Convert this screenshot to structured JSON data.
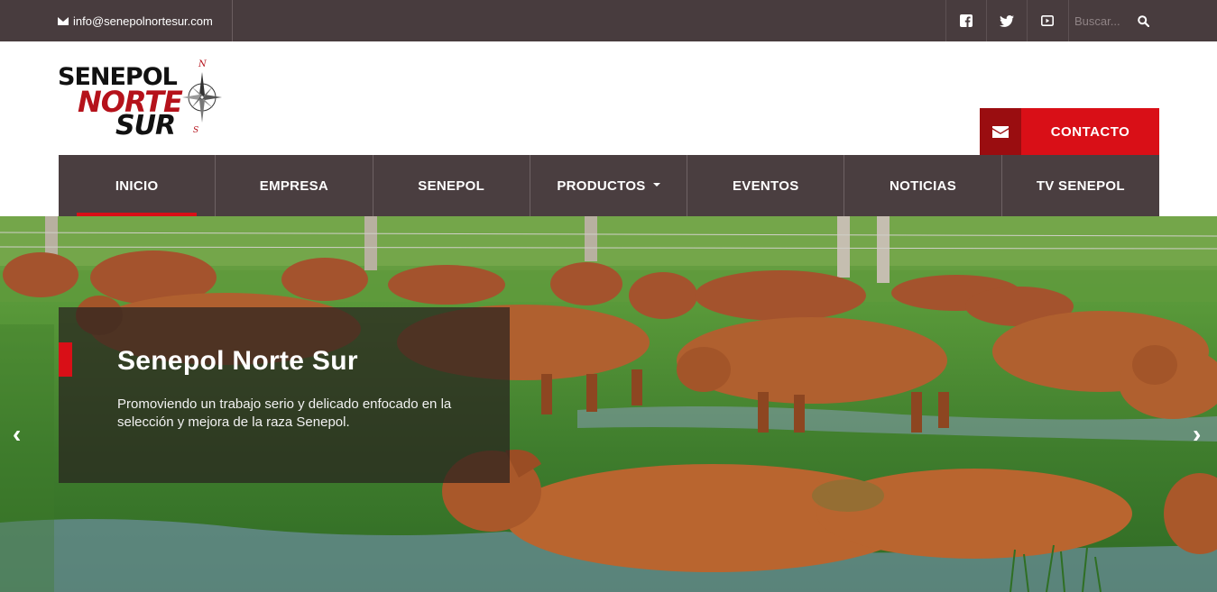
{
  "topbar": {
    "email": "info@senepolnortesur.com",
    "social": [
      {
        "icon": "facebook-icon"
      },
      {
        "icon": "twitter-icon"
      },
      {
        "icon": "youtube-icon"
      }
    ],
    "search_placeholder": "Buscar..."
  },
  "logo": {
    "line1": "SENEPOL",
    "line2": "NORTE",
    "line3": "SUR",
    "compass_n": "N",
    "compass_s": "S"
  },
  "contact": {
    "label": "CONTACTO",
    "icon": "envelope-icon"
  },
  "nav": {
    "items": [
      {
        "label": "INICIO",
        "active": true
      },
      {
        "label": "EMPRESA"
      },
      {
        "label": "SENEPOL"
      },
      {
        "label": "PRODUCTOS",
        "dropdown": true
      },
      {
        "label": "EVENTOS"
      },
      {
        "label": "NOTICIAS"
      },
      {
        "label": "TV SENEPOL"
      }
    ]
  },
  "hero": {
    "title": "Senepol Norte Sur",
    "text": "Promoviendo un trabajo serio y delicado enfocado en la selección y mejora de la raza Senepol.",
    "prev": "‹",
    "next": "›"
  },
  "colors": {
    "topbar": "#483c3e",
    "nav": "#4a3e40",
    "accent_red": "#d90f17",
    "dark_red": "#9a0d10"
  }
}
